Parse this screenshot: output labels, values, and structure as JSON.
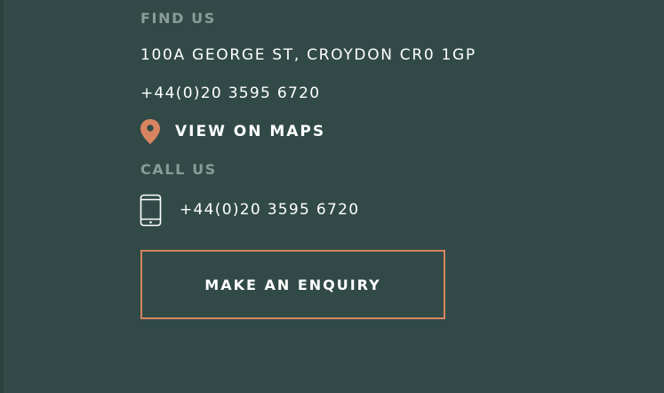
{
  "find_us": {
    "heading": "FIND US",
    "address": "100A GEORGE ST, CROYDON CR0 1GP",
    "phone": "+44(0)20 3595 6720",
    "maps_link_label": "VIEW ON MAPS",
    "maps_icon": "map-pin-icon"
  },
  "call_us": {
    "heading": "CALL US",
    "phone": "+44(0)20 3595 6720",
    "phone_icon": "mobile-phone-icon"
  },
  "cta": {
    "enquiry_label": "MAKE AN ENQUIRY"
  },
  "colors": {
    "background": "#314a47",
    "heading": "#8a9c98",
    "text": "#ffffff",
    "accent": "#d88461"
  }
}
